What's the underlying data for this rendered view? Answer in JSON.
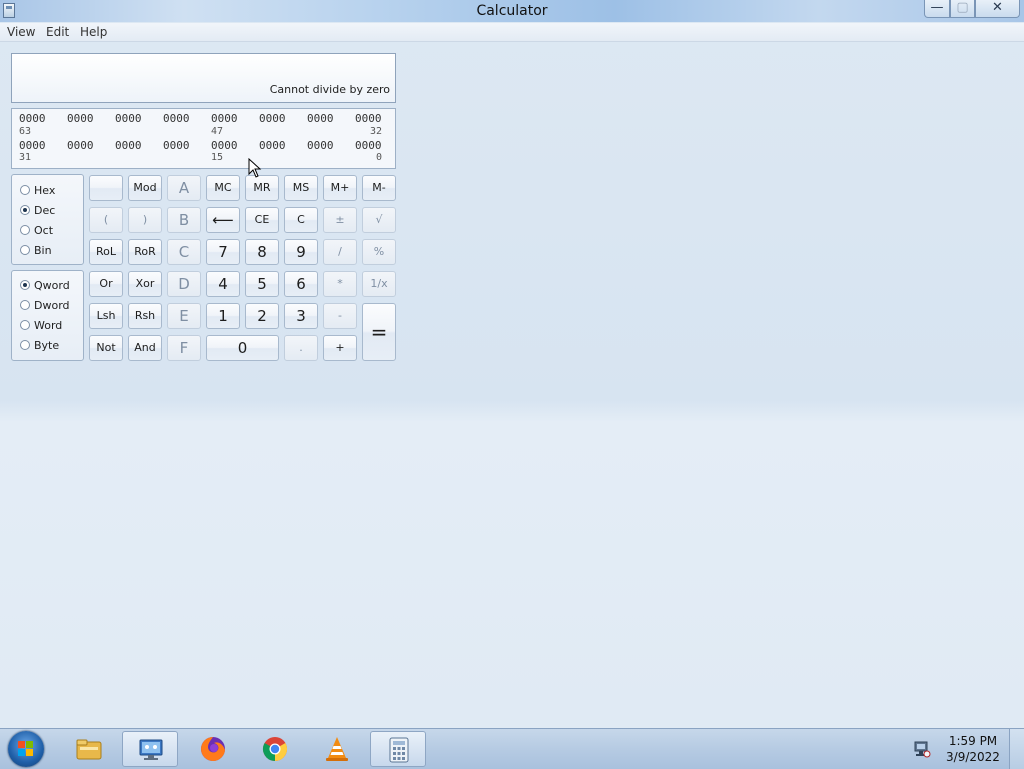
{
  "window": {
    "title": "Calculator",
    "controls": {
      "minimize": "—",
      "maximize": "▢",
      "close": "✕"
    }
  },
  "menu": [
    "View",
    "Edit",
    "Help"
  ],
  "display": {
    "text": "Cannot divide by zero"
  },
  "bits": {
    "row1": {
      "groups": [
        "0000",
        "0000",
        "0000",
        "0000",
        "0000",
        "0000",
        "0000",
        "0000"
      ],
      "indices": [
        "63",
        "47",
        "32"
      ]
    },
    "row2": {
      "groups": [
        "0000",
        "0000",
        "0000",
        "0000",
        "0000",
        "0000",
        "0000",
        "0000"
      ],
      "indices": [
        "31",
        "15",
        "0"
      ]
    }
  },
  "radix": {
    "options": [
      "Hex",
      "Dec",
      "Oct",
      "Bin"
    ],
    "selected": "Dec"
  },
  "wordsize": {
    "options": [
      "Qword",
      "Dword",
      "Word",
      "Byte"
    ],
    "selected": "Qword"
  },
  "keys": {
    "blank": "",
    "mod": "Mod",
    "A": "A",
    "MC": "MC",
    "MR": "MR",
    "MS": "MS",
    "Mplus": "M+",
    "Mminus": "M-",
    "lparen": "(",
    "rparen": ")",
    "B": "B",
    "back": "⟵",
    "CE": "CE",
    "C": "C",
    "plusminus": "±",
    "sqrt": "√",
    "RoL": "RoL",
    "RoR": "RoR",
    "hexC": "C",
    "n7": "7",
    "n8": "8",
    "n9": "9",
    "div": "/",
    "pct": "%",
    "Or": "Or",
    "Xor": "Xor",
    "D": "D",
    "n4": "4",
    "n5": "5",
    "n6": "6",
    "mul": "*",
    "recip": "1/x",
    "Lsh": "Lsh",
    "Rsh": "Rsh",
    "E": "E",
    "n1": "1",
    "n2": "2",
    "n3": "3",
    "sub": "-",
    "eq": "=",
    "Not": "Not",
    "And": "And",
    "F": "F",
    "n0": "0",
    "dot": ".",
    "add": "+"
  },
  "taskbar": {
    "items": [
      "start-button",
      "file-explorer",
      "network-tool",
      "firefox",
      "chrome",
      "vlc",
      "calculator"
    ],
    "clock": {
      "time": "1:59 PM",
      "date": "3/9/2022"
    }
  }
}
